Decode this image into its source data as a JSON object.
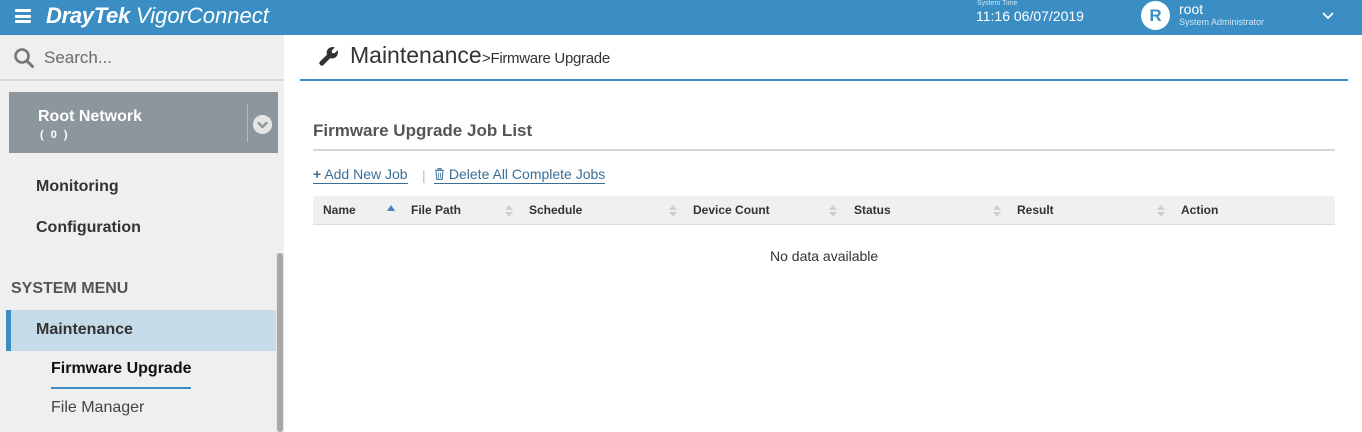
{
  "topbar": {
    "brand": "DrayTek",
    "product": "VigorConnect",
    "system_time_label": "System Time",
    "system_time": "11:16 06/07/2019",
    "avatar_letter": "R",
    "username": "root",
    "role": "System Administrator"
  },
  "sidebar": {
    "search_placeholder": "Search...",
    "network": {
      "name": "Root Network",
      "count": "( 0 )"
    },
    "items": [
      {
        "label": "Monitoring"
      },
      {
        "label": "Configuration"
      }
    ],
    "section_title": "SYSTEM MENU",
    "active_item": "Maintenance",
    "subitems": [
      {
        "label": "Firmware Upgrade",
        "active": true
      },
      {
        "label": "File Manager",
        "active": false
      }
    ]
  },
  "main": {
    "title": "Maintenance",
    "breadcrumb": ">Firmware Upgrade",
    "section_heading": "Firmware Upgrade Job List",
    "toolbar": {
      "add_icon": "+",
      "add_label": "Add New Job",
      "separator": "|",
      "delete_label": "Delete All Complete Jobs"
    },
    "table": {
      "columns": [
        "Name",
        "File Path",
        "Schedule",
        "Device Count",
        "Status",
        "Result",
        "Action"
      ],
      "empty_message": "No data available"
    }
  },
  "colors": {
    "accent": "#3a8ec4",
    "sidebar_bg": "#efefef",
    "network_bg": "#8c969d",
    "active_nav_bg": "#c5dbe8",
    "link": "#3a6e95"
  }
}
